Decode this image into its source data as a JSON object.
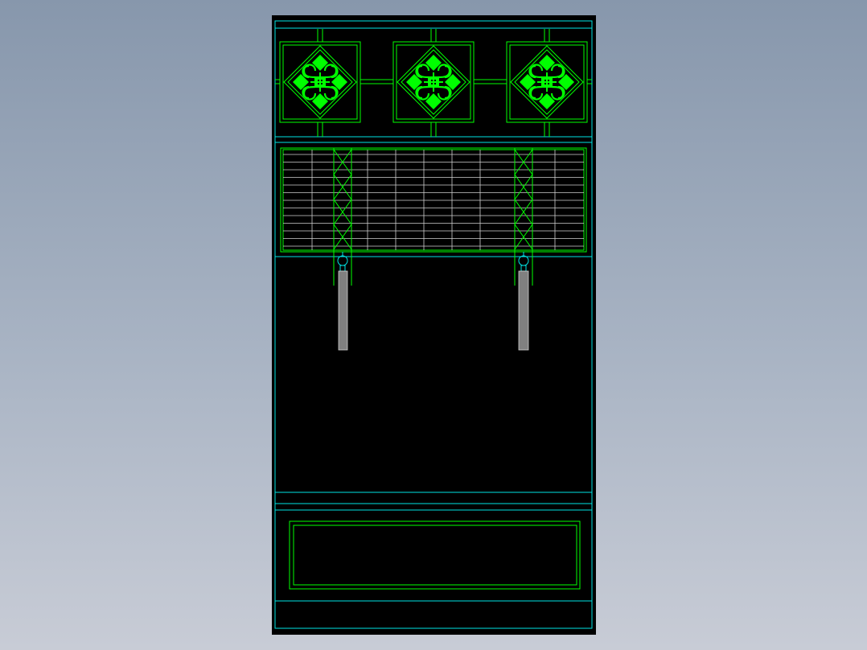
{
  "colors": {
    "background_top": "#8797ac",
    "background_bottom": "#c8ccd6",
    "paper": "#000000",
    "cyan_line": "#00e5e5",
    "green_line": "#00ff00",
    "ornament_fill": "#00ff00",
    "white_line": "#cfcfcf",
    "pole_fill": "#808080"
  },
  "drawing": {
    "ornament_count": 3,
    "hanging_pole_count": 2,
    "icon": "cad-elevation-drawing"
  }
}
